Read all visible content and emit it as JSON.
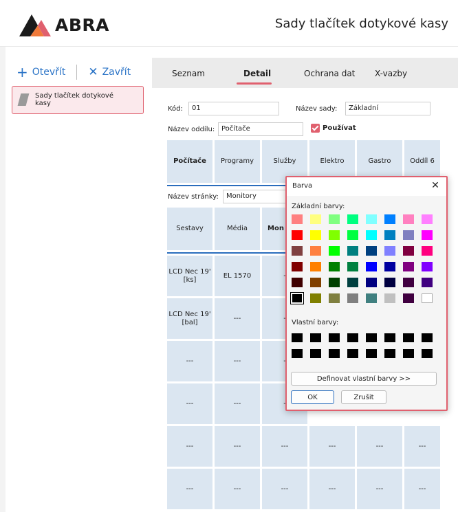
{
  "header": {
    "logo_text": "ABRA",
    "title": "Sady tlačítek dotykové kasy"
  },
  "sidebar": {
    "open_label": "Otevřít",
    "close_label": "Zavřít",
    "items": [
      {
        "label": "Sady tlačítek dotykové kasy"
      }
    ]
  },
  "tabs": [
    {
      "label": "Seznam",
      "active": false
    },
    {
      "label": "Detail",
      "active": true
    },
    {
      "label": "Ochrana dat",
      "active": false
    },
    {
      "label": "X-vazby",
      "active": false
    }
  ],
  "form": {
    "code_label": "Kód:",
    "code_value": "01",
    "set_name_label": "Název sady:",
    "set_name_value": "Základní",
    "section_name_label": "Název oddílu:",
    "section_name_value": "Počítače",
    "use_label": "Používat",
    "use_checked": true,
    "page_name_label": "Název stránky:",
    "page_name_value": "Monitory"
  },
  "section_tabs": [
    "Počítače",
    "Programy",
    "Služby",
    "Elektro",
    "Gastro",
    "Oddíl 6"
  ],
  "page_tabs": [
    "Sestavy",
    "Média",
    "Mon"
  ],
  "buttons_grid": [
    [
      "LCD Nec 19' [ks]",
      "EL 1570",
      "-"
    ],
    [
      "LCD Nec 19' [bal]",
      "---",
      "-"
    ],
    [
      "---",
      "---",
      "-"
    ],
    [
      "---",
      "---",
      "-"
    ],
    [
      "---",
      "---",
      "---",
      "---",
      "---",
      "---"
    ],
    [
      "---",
      "---",
      "---",
      "---",
      "---",
      "---"
    ]
  ],
  "color_dialog": {
    "title": "Barva",
    "basic_colors_label": "Základní barvy:",
    "custom_colors_label": "Vlastní barvy:",
    "define_button": "Definovat vlastní barvy >>",
    "ok_button": "OK",
    "cancel_button": "Zrušit",
    "basic_colors": [
      [
        "#ff8080",
        "#ffff80",
        "#80ff80",
        "#00ff80",
        "#80ffff",
        "#0080ff",
        "#ff80c0",
        "#ff80ff"
      ],
      [
        "#ff0000",
        "#ffff00",
        "#80ff00",
        "#00ff40",
        "#00ffff",
        "#0080c0",
        "#8080c0",
        "#ff00ff"
      ],
      [
        "#804040",
        "#ff8040",
        "#00ff00",
        "#008080",
        "#004080",
        "#8080ff",
        "#800040",
        "#ff0080"
      ],
      [
        "#800000",
        "#ff8000",
        "#008000",
        "#008040",
        "#0000ff",
        "#0000a0",
        "#800080",
        "#8000ff"
      ],
      [
        "#400000",
        "#804000",
        "#004000",
        "#004040",
        "#000080",
        "#000040",
        "#400040",
        "#400080"
      ],
      [
        "#000000",
        "#808000",
        "#808040",
        "#808080",
        "#408080",
        "#c0c0c0",
        "#400040",
        "#ffffff"
      ]
    ],
    "selected_color": "#000000",
    "custom_colors": [
      [
        "#000000",
        "#000000",
        "#000000",
        "#000000",
        "#000000",
        "#000000",
        "#000000",
        "#000000"
      ],
      [
        "#000000",
        "#000000",
        "#000000",
        "#000000",
        "#000000",
        "#000000",
        "#000000",
        "#000000"
      ]
    ]
  },
  "colors": {
    "accent": "#e0606e",
    "link": "#2b74c7",
    "grid": "#dbe6f1",
    "rule": "#2a6dbd"
  }
}
